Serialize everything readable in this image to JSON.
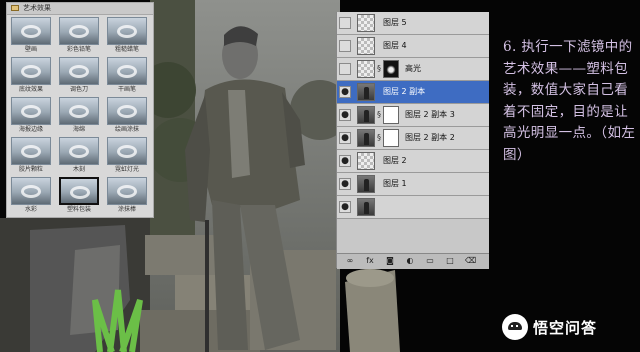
{
  "gallery": {
    "title": "艺术效果",
    "items": [
      {
        "label": "壁画"
      },
      {
        "label": "彩色铅笔"
      },
      {
        "label": "粗糙蜡笔"
      },
      {
        "label": "底纹效果"
      },
      {
        "label": "调色刀"
      },
      {
        "label": "干画笔"
      },
      {
        "label": "海报边缘"
      },
      {
        "label": "海绵"
      },
      {
        "label": "绘画涂抹"
      },
      {
        "label": "胶片颗粒"
      },
      {
        "label": "木刻"
      },
      {
        "label": "霓虹灯光"
      },
      {
        "label": "水彩"
      },
      {
        "label": "塑料包装"
      },
      {
        "label": "涂抹棒"
      }
    ],
    "selected_item": "塑料包装"
  },
  "layers": {
    "items": [
      {
        "name": "图层 5",
        "visible": false,
        "thumb": "transparent",
        "mask": "none"
      },
      {
        "name": "图层 4",
        "visible": false,
        "thumb": "transparent",
        "mask": "none"
      },
      {
        "name": "高光",
        "visible": false,
        "thumb": "transparent",
        "mask": "dark"
      },
      {
        "name": "图层 2 副本",
        "visible": true,
        "thumb": "photo",
        "mask": "none",
        "active": true
      },
      {
        "name": "图层 2 副本 3",
        "visible": true,
        "thumb": "photo",
        "mask": "white"
      },
      {
        "name": "图层 2 副本 2",
        "visible": true,
        "thumb": "photo",
        "mask": "white"
      },
      {
        "name": "图层 2",
        "visible": true,
        "thumb": "transparent",
        "mask": "none"
      },
      {
        "name": "图层 1",
        "visible": true,
        "thumb": "photo",
        "mask": "none"
      },
      {
        "name": "",
        "visible": true,
        "thumb": "photo",
        "mask": "none"
      }
    ],
    "footer_icons": [
      "link-icon",
      "fx-icon",
      "mask-icon",
      "adjustment-icon",
      "folder-icon",
      "new-layer-icon",
      "trash-icon"
    ]
  },
  "explanation": "6. 执行一下滤镜中的艺术效果——塑料包装，数值大家自己看着不固定，目的是让高光明显一点。（如左图）",
  "watermark": {
    "text": "悟空问答"
  },
  "colors": {
    "explanation_text": "#d4c1e4",
    "active_layer": "#3e6cc2",
    "panel_bg": "#c8c8c8"
  }
}
